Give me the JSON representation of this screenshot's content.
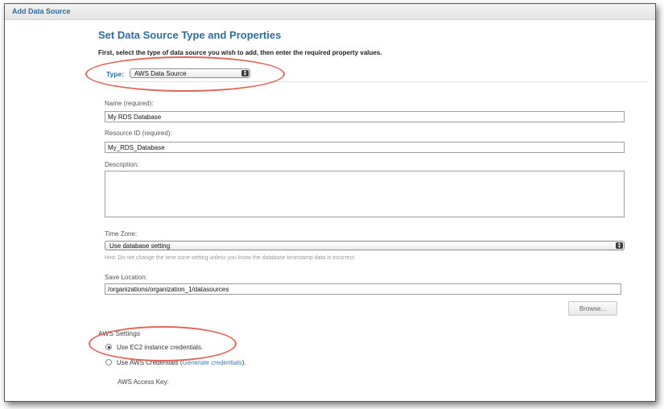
{
  "window": {
    "title": "Add Data Source"
  },
  "page": {
    "heading": "Set Data Source Type and Properties",
    "intro": "First, select the type of data source you wish to add, then enter the required property values."
  },
  "type_select": {
    "label": "Type:",
    "value": "AWS Data Source"
  },
  "fields": {
    "name": {
      "label": "Name (required):",
      "value": "My RDS Database"
    },
    "resource_id": {
      "label": "Resource ID (required):",
      "value": "My_RDS_Database"
    },
    "description": {
      "label": "Description:",
      "value": ""
    },
    "time_zone": {
      "label": "Time Zone:",
      "value": "Use database setting",
      "hint": "Hint: Do not change the time zone setting unless you know the database timestamp data is incorrect."
    },
    "save_location": {
      "label": "Save Location:",
      "value": "/organizations/organization_1/datasources"
    }
  },
  "browse_button": {
    "label": "Browse..."
  },
  "aws_settings": {
    "label": "AWS Settings",
    "option_ec2": {
      "label": "Use EC2 instance credentials.",
      "selected": true
    },
    "option_aws": {
      "label_before": "Use AWS Credentials (",
      "link": "Generate credentials",
      "label_after": ").",
      "selected": false
    },
    "access_key_label": "AWS Access Key:"
  },
  "colors": {
    "heading": "#2e6e9e",
    "link": "#3b7bb0",
    "highlight_ellipse": "#e0685b"
  }
}
